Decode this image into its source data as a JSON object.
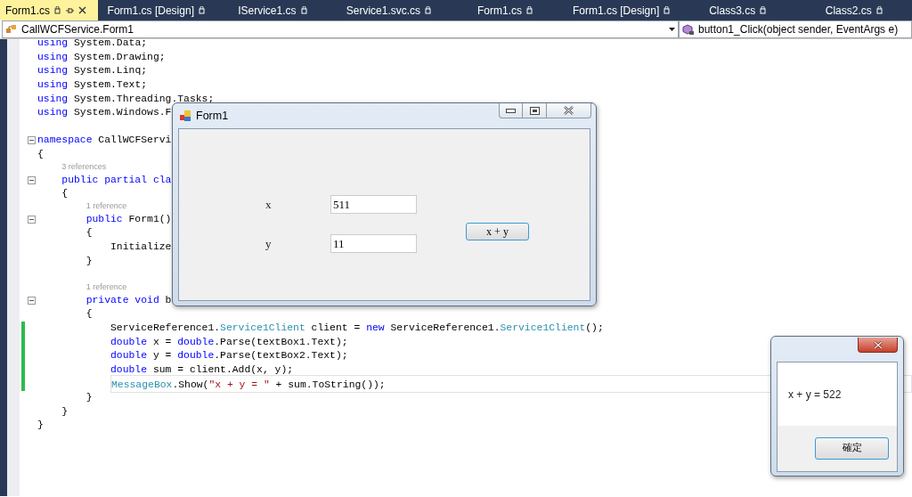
{
  "tabs": [
    {
      "label": "Form1.cs",
      "selected": true
    },
    {
      "label": "Form1.cs [Design]",
      "selected": false
    },
    {
      "label": "IService1.cs",
      "selected": false
    },
    {
      "label": "Service1.svc.cs",
      "selected": false
    },
    {
      "label": "Form1.cs",
      "selected": false
    },
    {
      "label": "Form1.cs [Design]",
      "selected": false
    },
    {
      "label": "Class3.cs",
      "selected": false
    },
    {
      "label": "Class2.cs",
      "selected": false
    }
  ],
  "navigation": {
    "type_dropdown": "CallWCFService.Form1",
    "member_dropdown": "button1_Click(object sender, EventArgs e)"
  },
  "code_lines": [
    {
      "kind": "code",
      "tokens": [
        {
          "text": "using",
          "kind": "kw"
        },
        {
          "text": " System.Data;",
          "kind": "plain"
        }
      ]
    },
    {
      "kind": "code",
      "tokens": [
        {
          "text": "using",
          "kind": "kw"
        },
        {
          "text": " System.Drawing;",
          "kind": "plain"
        }
      ]
    },
    {
      "kind": "code",
      "tokens": [
        {
          "text": "using",
          "kind": "kw"
        },
        {
          "text": " System.Linq;",
          "kind": "plain"
        }
      ]
    },
    {
      "kind": "code",
      "tokens": [
        {
          "text": "using",
          "kind": "kw"
        },
        {
          "text": " System.Text;",
          "kind": "plain"
        }
      ]
    },
    {
      "kind": "code",
      "tokens": [
        {
          "text": "using",
          "kind": "kw"
        },
        {
          "text": " System.Threading.Tasks;",
          "kind": "plain"
        }
      ]
    },
    {
      "kind": "code",
      "tokens": [
        {
          "text": "using",
          "kind": "kw"
        },
        {
          "text": " System.Windows.F",
          "kind": "plain"
        }
      ]
    },
    {
      "kind": "blank"
    },
    {
      "kind": "code",
      "foldable": true,
      "tokens": [
        {
          "text": "namespace",
          "kind": "kw"
        },
        {
          "text": " CallWCFServi",
          "kind": "plain"
        }
      ]
    },
    {
      "kind": "code",
      "tokens": [
        {
          "text": "{",
          "kind": "plain"
        }
      ],
      "children": [
        {
          "kind": "codelens",
          "text": "3 references"
        },
        {
          "kind": "code",
          "foldable": true,
          "tokens": [
            {
              "text": "public partial cla",
              "kind": "kw"
            }
          ]
        },
        {
          "kind": "code",
          "tokens": [
            {
              "text": "{",
              "kind": "plain"
            }
          ],
          "children": [
            {
              "kind": "codelens",
              "text": "1 reference"
            },
            {
              "kind": "code",
              "foldable": true,
              "tokens": [
                {
                  "text": "public",
                  "kind": "kw"
                },
                {
                  "text": " Form1()",
                  "kind": "plain"
                }
              ]
            },
            {
              "kind": "code",
              "tokens": [
                {
                  "text": "{",
                  "kind": "plain"
                }
              ],
              "children": [
                {
                  "kind": "code",
                  "tokens": [
                    {
                      "text": "Initialize",
                      "kind": "plain"
                    }
                  ]
                }
              ]
            },
            {
              "kind": "code",
              "tokens": [
                {
                  "text": "}",
                  "kind": "plain"
                }
              ]
            },
            {
              "kind": "blank"
            },
            {
              "kind": "codelens",
              "text": "1 reference"
            },
            {
              "kind": "code",
              "foldable": true,
              "tokens": [
                {
                  "text": "private void",
                  "kind": "kw"
                },
                {
                  "text": " b",
                  "kind": "plain"
                }
              ]
            },
            {
              "kind": "code",
              "tokens": [
                {
                  "text": "{",
                  "kind": "plain"
                }
              ],
              "children": [
                {
                  "kind": "code",
                  "changed": true,
                  "tokens": [
                    {
                      "text": "ServiceReference1.",
                      "kind": "plain"
                    },
                    {
                      "text": "Service1Client",
                      "kind": "type"
                    },
                    {
                      "text": " client = ",
                      "kind": "plain"
                    },
                    {
                      "text": "new",
                      "kind": "kw"
                    },
                    {
                      "text": " ServiceReference1.",
                      "kind": "plain"
                    },
                    {
                      "text": "Service1Client",
                      "kind": "type"
                    },
                    {
                      "text": "();",
                      "kind": "plain"
                    }
                  ]
                },
                {
                  "kind": "code",
                  "changed": true,
                  "tokens": [
                    {
                      "text": "double",
                      "kind": "kw"
                    },
                    {
                      "text": " x = ",
                      "kind": "plain"
                    },
                    {
                      "text": "double",
                      "kind": "kw"
                    },
                    {
                      "text": ".Parse(textBox1.Text);",
                      "kind": "plain"
                    }
                  ]
                },
                {
                  "kind": "code",
                  "changed": true,
                  "tokens": [
                    {
                      "text": "double",
                      "kind": "kw"
                    },
                    {
                      "text": " y = ",
                      "kind": "plain"
                    },
                    {
                      "text": "double",
                      "kind": "kw"
                    },
                    {
                      "text": ".Parse(textBox2.Text);",
                      "kind": "plain"
                    }
                  ]
                },
                {
                  "kind": "code",
                  "changed": true,
                  "tokens": [
                    {
                      "text": "double",
                      "kind": "kw"
                    },
                    {
                      "text": " sum = client.Add(x, y);",
                      "kind": "plain"
                    }
                  ]
                },
                {
                  "kind": "code",
                  "changed": true,
                  "current": true,
                  "tokens": [
                    {
                      "text": "MessageBox",
                      "kind": "type"
                    },
                    {
                      "text": ".Show(",
                      "kind": "plain"
                    },
                    {
                      "text": "\"x + y = \"",
                      "kind": "str"
                    },
                    {
                      "text": " + sum.ToString());",
                      "kind": "plain"
                    }
                  ]
                }
              ]
            },
            {
              "kind": "code",
              "tokens": [
                {
                  "text": "}",
                  "kind": "plain"
                }
              ]
            }
          ]
        },
        {
          "kind": "code",
          "tokens": [
            {
              "text": "}",
              "kind": "plain"
            }
          ]
        }
      ]
    },
    {
      "kind": "code",
      "tokens": [
        {
          "text": "}",
          "kind": "plain"
        }
      ]
    }
  ],
  "form_window": {
    "title": "Form1",
    "fields": [
      {
        "label": "x",
        "value": "511"
      },
      {
        "label": "y",
        "value": "11"
      }
    ],
    "button": "x + y"
  },
  "message_box": {
    "message": "x + y = 522",
    "button": "確定"
  }
}
